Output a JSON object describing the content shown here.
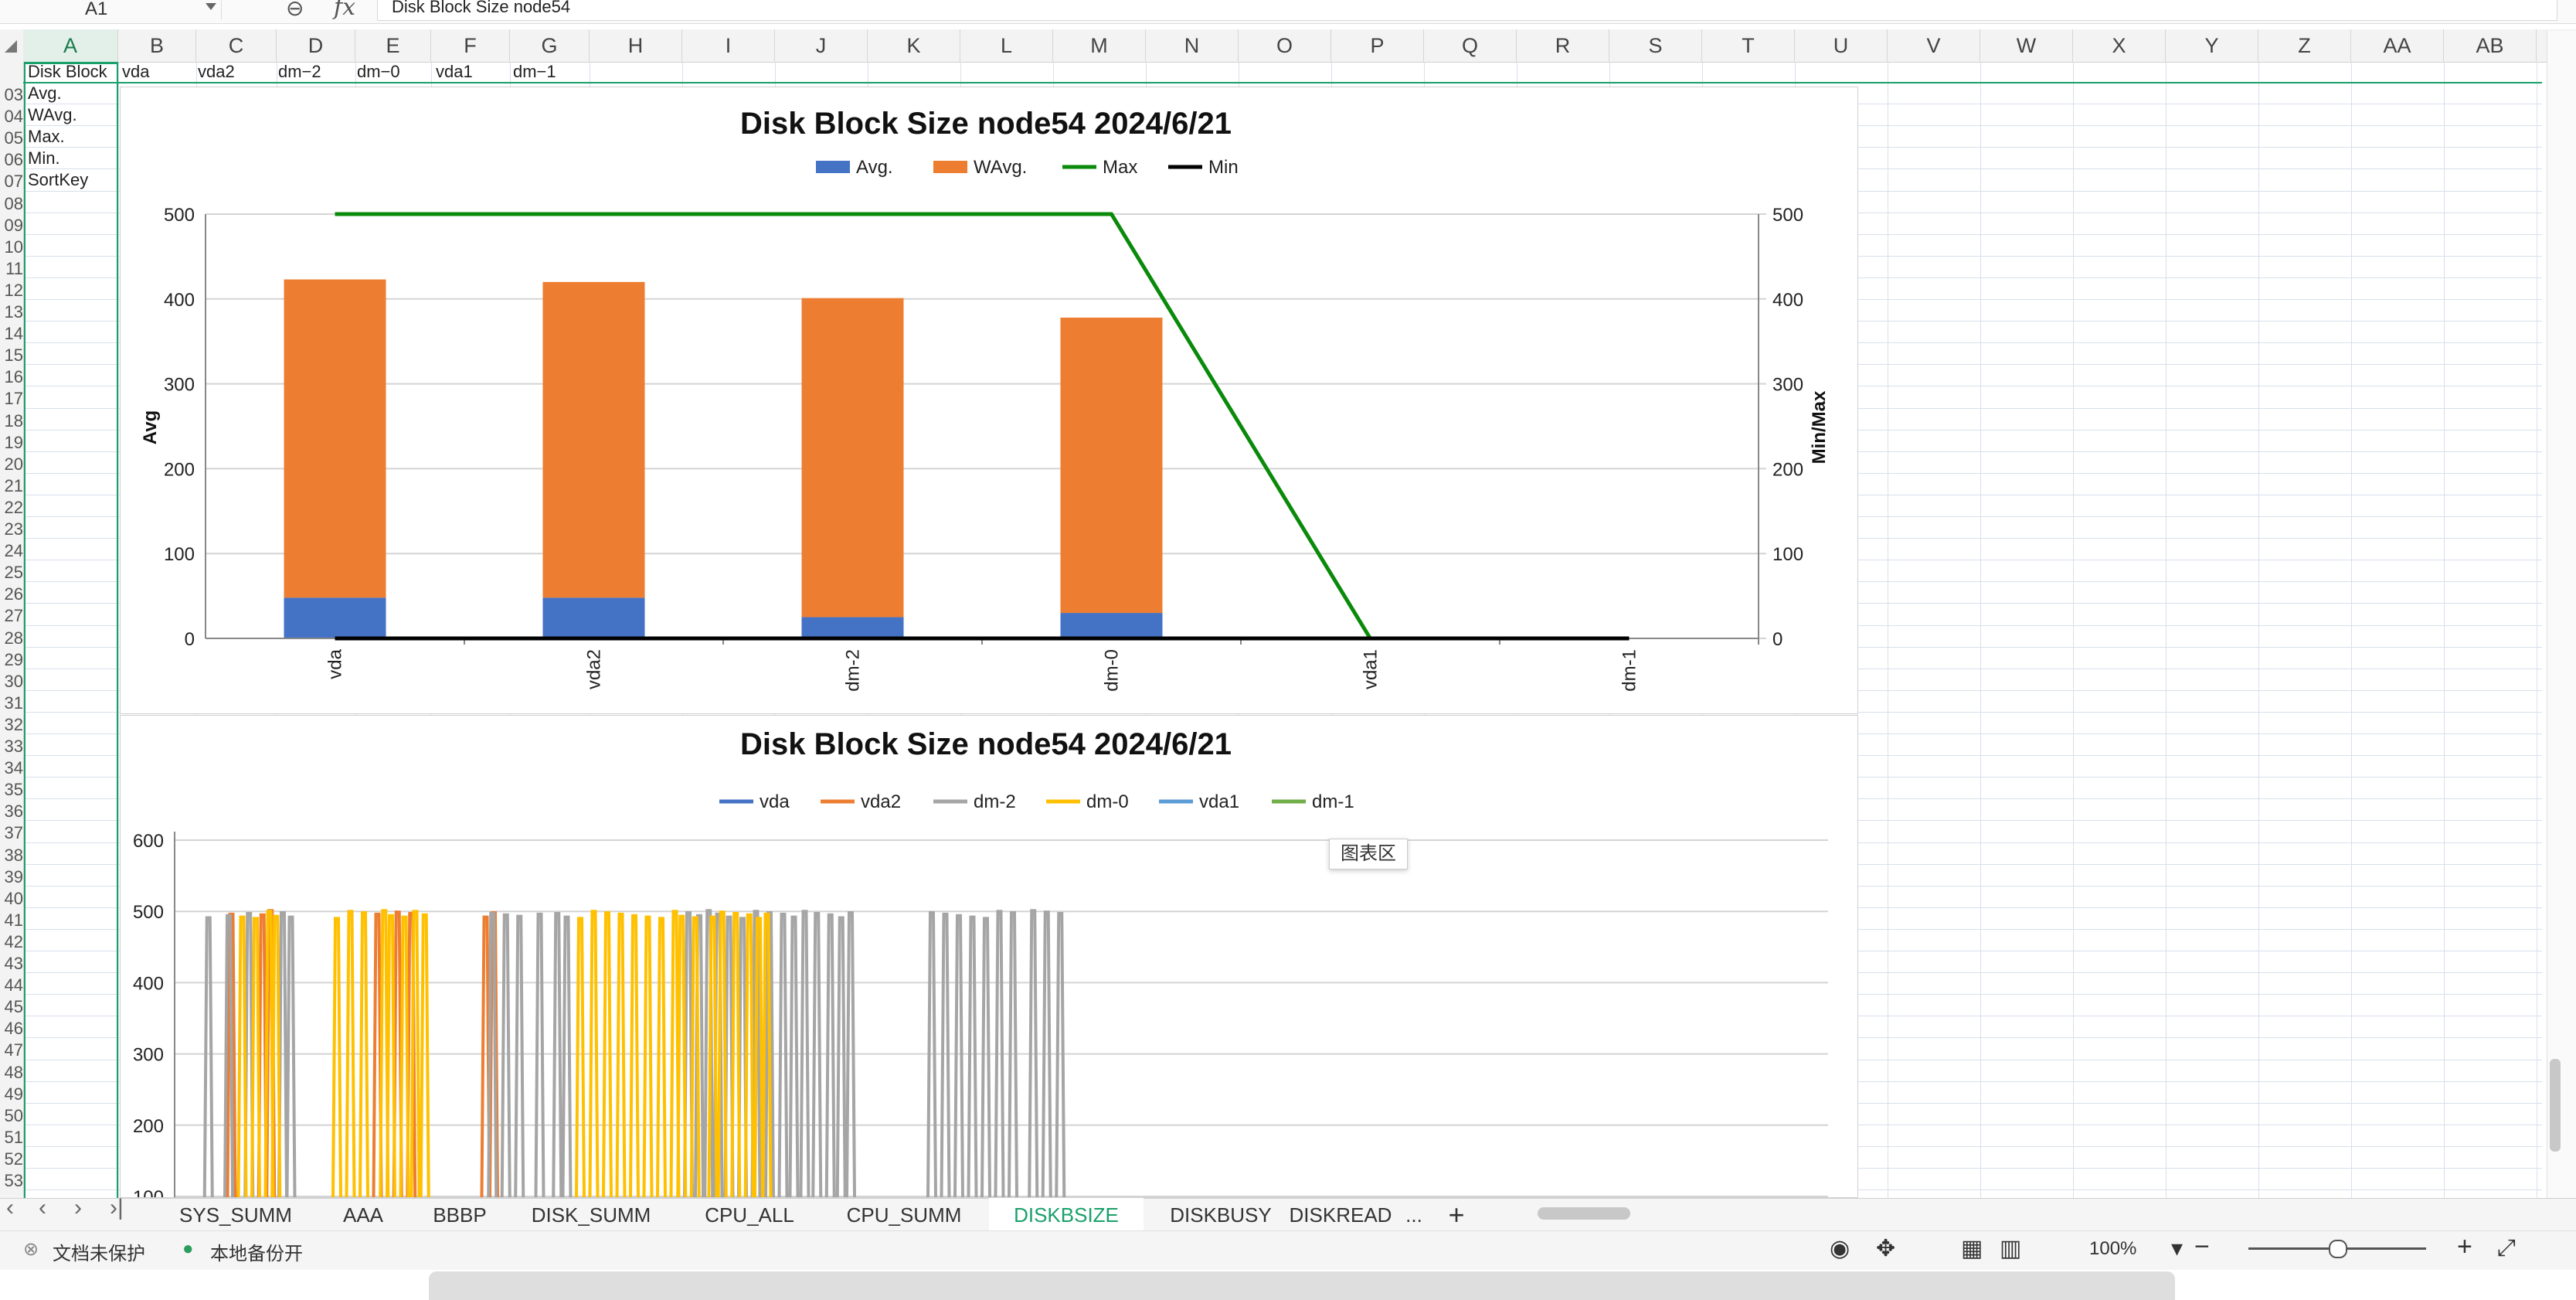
{
  "formula_bar": {
    "cell_ref": "A1",
    "fx_label": "fx",
    "content": "Disk Block Size node54"
  },
  "columns": [
    "A",
    "B",
    "C",
    "D",
    "E",
    "F",
    "G",
    "H",
    "I",
    "J",
    "K",
    "L",
    "M",
    "N",
    "O",
    "P",
    "Q",
    "R",
    "S",
    "T",
    "U",
    "V",
    "W",
    "X",
    "Y",
    "Z",
    "AA",
    "AB"
  ],
  "rows": [
    "03",
    "04",
    "05",
    "06",
    "07",
    "08",
    "09",
    "10",
    "11",
    "12",
    "13",
    "14",
    "15",
    "16",
    "17",
    "18",
    "19",
    "20",
    "21",
    "22",
    "23",
    "24",
    "25",
    "26",
    "27",
    "28",
    "29",
    "30",
    "31",
    "32",
    "33",
    "34",
    "35",
    "36",
    "37",
    "38",
    "39",
    "40",
    "41",
    "42",
    "43",
    "44",
    "45",
    "46",
    "47",
    "48",
    "49",
    "50",
    "51",
    "52",
    "53"
  ],
  "cells": {
    "header_a": "Disk  Block",
    "header_b": "vda",
    "header_c": "vda2",
    "header_d": "dm−2",
    "header_e": "dm−0",
    "header_f": "vda1",
    "header_g": "dm−1",
    "row_labels": [
      "Avg.",
      "WAvg.",
      "Max.",
      "Min.",
      "SortKey"
    ]
  },
  "chart_data": [
    {
      "type": "bar",
      "title": "Disk Block Size node54  2024/6/21",
      "categories": [
        "vda",
        "vda2",
        "dm-2",
        "dm-0",
        "vda1",
        "dm-1"
      ],
      "series": [
        {
          "name": "Avg.",
          "kind": "bar",
          "axis": "left",
          "color": "#4472c4",
          "values": [
            48,
            48,
            25,
            30,
            0,
            0
          ]
        },
        {
          "name": "WAvg.",
          "kind": "bar",
          "axis": "left",
          "color": "#ed7d31",
          "values": [
            375,
            372,
            376,
            348,
            0,
            0
          ]
        },
        {
          "name": "Max",
          "kind": "line",
          "axis": "right",
          "color": "#0a8a0a",
          "values": [
            500,
            500,
            500,
            500,
            0,
            0
          ]
        },
        {
          "name": "Min",
          "kind": "line",
          "axis": "right",
          "color": "#000000",
          "values": [
            0,
            0,
            0,
            0,
            0,
            0
          ]
        }
      ],
      "stacked": true,
      "ylabel": "Avg",
      "y2label": "Min/Max",
      "ylim": [
        0,
        500
      ],
      "y2lim": [
        0,
        500
      ],
      "yticks": [
        0,
        100,
        200,
        300,
        400,
        500
      ],
      "legend": "top",
      "grid": true
    },
    {
      "type": "line",
      "title": "Disk Block Size node54  2024/6/21",
      "series": [
        {
          "name": "vda",
          "color": "#4472c4",
          "spikes": []
        },
        {
          "name": "vda2",
          "color": "#ed7d31",
          "spikes": [
            42,
            65,
            71,
            150,
            165,
            175,
            230,
            236
          ]
        },
        {
          "name": "dm-2",
          "color": "#a5a5a5",
          "spikes": [
            25,
            40,
            55,
            80,
            86,
            235,
            245,
            255,
            270,
            283,
            290,
            380,
            388,
            395,
            402,
            410,
            420,
            430,
            440,
            450,
            458,
            466,
            475,
            485,
            493,
            500,
            560,
            570,
            580,
            590,
            600,
            610,
            620,
            635,
            645,
            655
          ]
        },
        {
          "name": "dm-0",
          "color": "#ffc000",
          "spikes": [
            50,
            60,
            70,
            75,
            120,
            130,
            140,
            155,
            160,
            170,
            178,
            185,
            300,
            310,
            320,
            330,
            340,
            350,
            360,
            370,
            375,
            385,
            398,
            405,
            415,
            425,
            432,
            438
          ]
        },
        {
          "name": "vda1",
          "color": "#5b9bd5",
          "spikes": []
        },
        {
          "name": "dm-1",
          "color": "#70ad47",
          "spikes": []
        }
      ],
      "ylim": [
        100,
        600
      ],
      "yticks": [
        100,
        200,
        300,
        400,
        500,
        600
      ],
      "legend": "top",
      "grid": true
    }
  ],
  "chart_tooltip": "图表区",
  "sheet_tabs": [
    "SYS_SUMM",
    "AAA",
    "BBBP",
    "DISK_SUMM",
    "CPU_ALL",
    "CPU_SUMM",
    "DISKBSIZE",
    "DISKBUSY",
    "DISKREAD",
    "..."
  ],
  "active_tab": "DISKBSIZE",
  "add_tab": "+",
  "status": {
    "protect": "文档未保护",
    "backup": "本地备份开",
    "zoom": "100%"
  },
  "colors": {
    "accent": "#1aa06a"
  }
}
